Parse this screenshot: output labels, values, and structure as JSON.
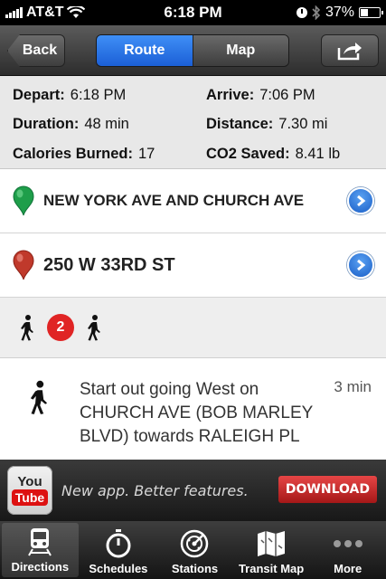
{
  "status_bar": {
    "carrier": "AT&T",
    "time": "6:18 PM",
    "battery": "37%"
  },
  "nav": {
    "back_label": "Back",
    "segments": [
      "Route",
      "Map"
    ],
    "selected_segment": "Route",
    "share_icon": "share-icon"
  },
  "stats": {
    "depart_label": "Depart:",
    "depart_value": "6:18 PM",
    "arrive_label": "Arrive:",
    "arrive_value": "7:06 PM",
    "duration_label": "Duration:",
    "duration_value": "48 min",
    "distance_label": "Distance:",
    "distance_value": "7.30 mi",
    "calories_label": "Calories Burned:",
    "calories_value": "17",
    "co2_label": "CO2 Saved:",
    "co2_value": "8.41 lb"
  },
  "origin": {
    "label": "NEW YORK AVE AND CHURCH AVE",
    "pin_color": "#1e9e4a"
  },
  "destination": {
    "label": "250 W 33RD ST",
    "pin_color": "#c0392b"
  },
  "modes": {
    "line": "2",
    "line_color": "#e02424"
  },
  "step": {
    "instruction": "Start out going West on CHURCH AVE (BOB MARLEY BLVD) towards RALEIGH PL",
    "duration": "3 min"
  },
  "ad": {
    "logo_you": "You",
    "logo_tube": "Tube",
    "tagline": "New app. Better features.",
    "cta": "DOWNLOAD"
  },
  "tabs": [
    {
      "label": "Directions",
      "icon": "train-icon"
    },
    {
      "label": "Schedules",
      "icon": "stopwatch-icon"
    },
    {
      "label": "Stations",
      "icon": "radar-icon"
    },
    {
      "label": "Transit Map",
      "icon": "map-icon"
    },
    {
      "label": "More",
      "icon": "more-icon"
    }
  ],
  "active_tab": "Directions"
}
